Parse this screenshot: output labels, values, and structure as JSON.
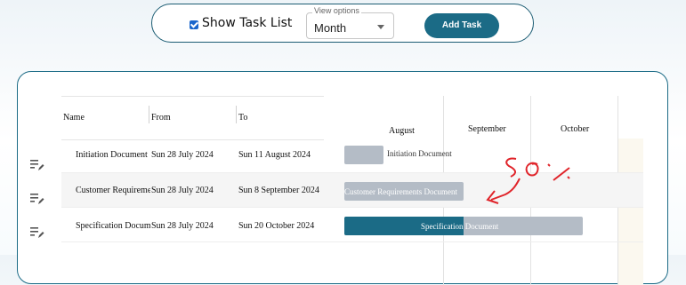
{
  "toolbar": {
    "show_task_list_label": "Show Task List",
    "view_options_legend": "View options",
    "view_value": "Month",
    "add_task_label": "Add Task"
  },
  "table": {
    "headers": {
      "name": "Name",
      "from": "From",
      "to": "To"
    },
    "rows": [
      {
        "name": "Initiation Document",
        "from": "Sun 28 July 2024",
        "to": "Sun 11 August 2024"
      },
      {
        "name": "Customer Requirements Document",
        "from": "Sun 28 July 2024",
        "to": "Sun 8 September 2024"
      },
      {
        "name": "Specification Document",
        "from": "Sun 28 July 2024",
        "to": "Sun 20 October 2024"
      }
    ]
  },
  "gantt": {
    "months": [
      "August",
      "September",
      "October"
    ],
    "bars": [
      {
        "label": "Initiation Document",
        "progress": 0
      },
      {
        "label": "Customer Requirements Document",
        "progress": 0
      },
      {
        "label": "Specification Document",
        "progress": 50
      }
    ],
    "colors": {
      "bar_bg": "#b4bcc6",
      "bar_progress": "#1b6b86"
    }
  },
  "annotation": {
    "text": "50%"
  }
}
